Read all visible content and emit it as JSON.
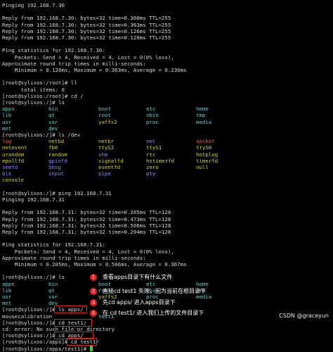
{
  "colors": {
    "text": "#d8d8d8",
    "dir": "#5fd7d7",
    "device": "#d7d700",
    "device_red": "#ff5f5f",
    "device_blue": "#8787ff",
    "cursor": "#3cd23c",
    "annotation": "#e02020"
  },
  "terminal_lines": [
    "Pinging 192.168.7.30",
    "",
    "Reply from 192.168.7.30: bytes=32 time=0.300ms TTL=255",
    "Reply from 192.168.7.30: bytes=32 time=0.363ms TTL=255",
    "Reply from 192.168.7.30: bytes=32 time=0.126ms TTL=255",
    "Reply from 192.168.7.30: bytes=32 time=0.126ms TTL=255",
    "",
    "Ping statistics for 192.168.7.30:",
    "    Packets: Send = 4, Received = 4, Lost = 0(0% loss),",
    "Approximate round trip times in milli-seconds:",
    "    Minimum = 0.126ms, Maximum = 0.363ms, Average = 0.236ms",
    "",
    "[root@sylixos:/root]# ll",
    "      total items: 0",
    "[root@sylixos:/root]# cd /",
    "[root@sylixos:/]# ls",
    "",
    "",
    "",
    "",
    "[root@sylixos:/]# ls /dev",
    "",
    "",
    "",
    "",
    "",
    "",
    "",
    "",
    "[root@sylixos:/]# ping 192.168.7.31",
    "Pinging 192.168.7.31",
    "",
    "Reply from 192.168.7.31: bytes=32 time=0.205ms TTL=128",
    "Reply from 192.168.7.31: bytes=32 time=0.473ms TTL=128",
    "Reply from 192.168.7.31: bytes=32 time=0.506ms TTL=128",
    "Reply from 192.168.7.31: bytes=32 time=0.294ms TTL=128",
    "",
    "Ping statistics for 192.168.7.31:",
    "    Packets: Send = 4, Received = 4, Lost = 0(0% loss),",
    "Approximate round trip times in milli-seconds:",
    "    Minimum = 0.205ms, Maximum = 0.506ms, Average = 0.367ms",
    "",
    "[root@sylixos:/]# ls",
    "",
    "",
    "",
    "",
    "[root@sylixos:/]# ls apps/",
    "mousecalibration",
    "[root@sylixos:/]# cd test1/",
    "cd: error: No such file or directory",
    "[root@sylixos:/]# cd apps/",
    "[root@sylixos:/apps]# cd test1/",
    "[root@sylixos:/apps/test1]# "
  ],
  "grid_rows": [
    {
      "line": 16,
      "cells": [
        {
          "t": "apps",
          "c": "dir"
        },
        {
          "t": "bin",
          "c": "dir"
        },
        {
          "t": "boot",
          "c": "dir"
        },
        {
          "t": "etc",
          "c": "dir"
        },
        {
          "t": "home",
          "c": "dir"
        }
      ]
    },
    {
      "line": 17,
      "cells": [
        {
          "t": "lib",
          "c": "dir"
        },
        {
          "t": "qt",
          "c": "dir"
        },
        {
          "t": "root",
          "c": "dir"
        },
        {
          "t": "sbin",
          "c": "dir"
        },
        {
          "t": "tmp",
          "c": "dir"
        }
      ]
    },
    {
      "line": 18,
      "cells": [
        {
          "t": "usr",
          "c": "dir"
        },
        {
          "t": "var",
          "c": "dir"
        },
        {
          "t": "yaffs2",
          "c": "device"
        },
        {
          "t": "proc",
          "c": "dir"
        },
        {
          "t": "media",
          "c": "dir"
        }
      ]
    },
    {
      "line": 19,
      "cells": [
        {
          "t": "mnt",
          "c": "dir"
        },
        {
          "t": "dev",
          "c": "dir"
        }
      ]
    },
    {
      "line": 21,
      "cells": [
        {
          "t": "log",
          "c": "device_red"
        },
        {
          "t": "netbd",
          "c": "device"
        },
        {
          "t": "netbr",
          "c": "device"
        },
        {
          "t": "net",
          "c": "device_blue"
        },
        {
          "t": "socket",
          "c": "device_red"
        }
      ]
    },
    {
      "line": 22,
      "cells": [
        {
          "t": "netevent",
          "c": "device"
        },
        {
          "t": "fb0",
          "c": "device"
        },
        {
          "t": "ttyS2",
          "c": "device"
        },
        {
          "t": "ttyS1",
          "c": "device"
        },
        {
          "t": "ttyS0",
          "c": "device"
        }
      ]
    },
    {
      "line": 23,
      "cells": [
        {
          "t": "urandom",
          "c": "device"
        },
        {
          "t": "random",
          "c": "device"
        },
        {
          "t": "shm",
          "c": "device_blue"
        },
        {
          "t": "rtc",
          "c": "device"
        },
        {
          "t": "hotplug",
          "c": "device"
        }
      ]
    },
    {
      "line": 24,
      "cells": [
        {
          "t": "epollfd",
          "c": "device"
        },
        {
          "t": "gpiofd",
          "c": "device_blue"
        },
        {
          "t": "signalfd",
          "c": "device"
        },
        {
          "t": "hstimerfd",
          "c": "device"
        },
        {
          "t": "timerfd",
          "c": "device"
        }
      ]
    },
    {
      "line": 25,
      "cells": [
        {
          "t": "semfd",
          "c": "device_blue"
        },
        {
          "t": "bmsg",
          "c": "device_blue"
        },
        {
          "t": "eventfd",
          "c": "device"
        },
        {
          "t": "zero",
          "c": "device"
        },
        {
          "t": "null",
          "c": "device"
        }
      ]
    },
    {
      "line": 26,
      "cells": [
        {
          "t": "blk",
          "c": "device_blue"
        },
        {
          "t": "input",
          "c": "device_blue"
        },
        {
          "t": "pipe",
          "c": "device_blue"
        },
        {
          "t": "pty",
          "c": "device_blue"
        }
      ]
    },
    {
      "line": 27,
      "cells": [
        {
          "t": "console",
          "c": "device"
        },
        {
          "t": "",
          "c": "device"
        }
      ]
    },
    {
      "line": 43,
      "cells": [
        {
          "t": "apps",
          "c": "dir"
        },
        {
          "t": "bin",
          "c": "dir"
        },
        {
          "t": "boot",
          "c": "dir"
        },
        {
          "t": "etc",
          "c": "dir"
        },
        {
          "t": "home",
          "c": "dir"
        }
      ]
    },
    {
      "line": 44,
      "cells": [
        {
          "t": "lib",
          "c": "dir"
        },
        {
          "t": "qt",
          "c": "dir"
        },
        {
          "t": "root",
          "c": "dir"
        },
        {
          "t": "sbin",
          "c": "dir"
        },
        {
          "t": "tmp",
          "c": "dir"
        }
      ]
    },
    {
      "line": 45,
      "cells": [
        {
          "t": "usr",
          "c": "dir"
        },
        {
          "t": "var",
          "c": "dir"
        },
        {
          "t": "yaffs2",
          "c": "device"
        },
        {
          "t": "proc",
          "c": "dir"
        },
        {
          "t": "media",
          "c": "dir"
        }
      ]
    },
    {
      "line": 46,
      "cells": [
        {
          "t": "mnt",
          "c": "dir"
        },
        {
          "t": "dev",
          "c": "dir"
        }
      ]
    },
    {
      "line": 48,
      "cells": [
        {
          "t": "",
          "c": "dir"
        },
        {
          "t": "",
          "c": "dir"
        },
        {
          "t": "test1",
          "c": "dir"
        }
      ]
    }
  ],
  "annotations": [
    {
      "num": "1",
      "text": "查看apps目录下有什么文件"
    },
    {
      "num": "2",
      "text": "直接cd test1 失败，因为当前在根目录下"
    },
    {
      "num": "3",
      "text": "先cd apps/ 进入apps目录下"
    },
    {
      "num": "4",
      "text": "在 cd test1/ 进入我们上传的文件目录下"
    }
  ],
  "watermark": "CSDN @graceyun"
}
